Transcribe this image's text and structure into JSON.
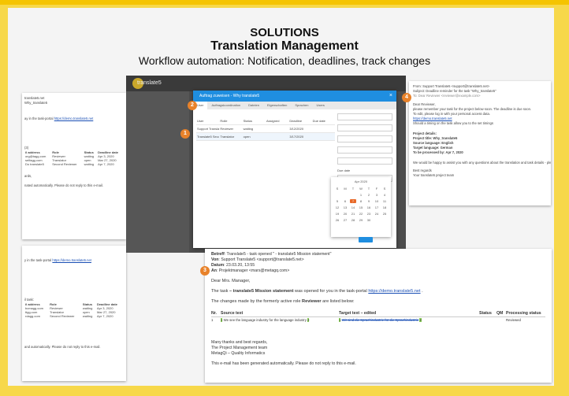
{
  "slide": {
    "title": "SOLUTIONS",
    "subtitle": "Translation Management",
    "tagline": "Workflow automation: Notification, deadlines, track changes"
  },
  "app": {
    "name": "translate5"
  },
  "dialog": {
    "title": "Auftrag zuweisen - Why translate5",
    "tabs": [
      "User",
      "Auftragskoordination",
      "Dateien",
      "Eigenschaften",
      "Sprachen",
      "Users"
    ],
    "columns": [
      "User",
      "Rolle",
      "Status",
      "Assigned",
      "Deadline",
      "Due date"
    ],
    "rows": [
      [
        "Support Translate5 Manager",
        "Reviewer",
        "waiting",
        "",
        "3/12/2020",
        ""
      ],
      [
        "Translate5 Second Reviewer",
        "Translator",
        "open",
        "",
        "3/17/2020",
        ""
      ]
    ],
    "side_label": "Due date",
    "calendar": {
      "header": "Apr 2020",
      "days": [
        "S",
        "M",
        "T",
        "W",
        "T",
        "F",
        "S",
        "",
        "",
        "",
        "1",
        "2",
        "3",
        "4",
        "5",
        "6",
        "7",
        "8",
        "9",
        "10",
        "11",
        "12",
        "13",
        "14",
        "15",
        "16",
        "17",
        "18",
        "19",
        "20",
        "21",
        "22",
        "23",
        "24",
        "25",
        "26",
        "27",
        "28",
        "29",
        "30",
        "",
        ""
      ]
    }
  },
  "email_right": {
    "from": "From: Support Translate5 <support@translate5.net>",
    "subject": "Subject: Deadline reminder for the task \"Why_translate5\"",
    "to": "To: Dear Reviewer <reviewer@example.com>",
    "greeting": "Dear Reviewer,",
    "body1": "please remember your task for the project below soon. The deadline is due soon.",
    "body2": "To edit, please log in with your personal access data.",
    "link": "https://demo.translate5.net",
    "body3": "Should a timing on the task allow you to the set timings",
    "details_title": "Project details:",
    "details": [
      "Project title: Why_translate5",
      "Source language: English",
      "Target language: German",
      "To be processed by: Apr 7, 2020"
    ],
    "closing": "We would be happy to assist you with any questions about the translation and task details - please",
    "regards": "Best regards",
    "sign": "Your translate5 project team"
  },
  "email_left": {
    "line1": "translate5.net",
    "line2": "Why_translate5",
    "portal": "ay in the task-portal",
    "portal_link": "https://demo.translate5.net",
    "users_label": "(3)",
    "table_head": [
      "il address",
      "Role",
      "Status",
      "Deadline date"
    ],
    "table_rows": [
      [
        "org@tagg.com",
        "Reviewer",
        "waiting",
        "Apr 3, 2020"
      ],
      [
        "selfagg.com",
        "Translator",
        "open",
        "Mar 27, 2020"
      ],
      [
        "Do translate5",
        "Second Reviewer",
        "waiting",
        "Apr 7, 2020"
      ]
    ],
    "footer1": "ards,",
    "footer2": "nated automatically. Please do not reply to this e-mail.",
    "portal2": "y in the task-portal",
    "portal2_link": "https://demo.translate5.net",
    "table2_title": "il task:",
    "table2_head": [
      "il address",
      "Role",
      "Status",
      "Deadline date"
    ],
    "table2_rows": [
      [
        "bcmagg.com",
        "Reviewer",
        "waiting",
        "Apr 3, 2020"
      ],
      [
        "ttgg.com",
        "Translator",
        "open",
        "Mar 27, 2020"
      ],
      [
        "rdagg.com",
        "Second Reviewer",
        "waiting",
        "Apr 7, 2020"
      ]
    ],
    "footer3": "and automatically. Please do not reply to this e-mail."
  },
  "email_big": {
    "from_label": "Betreff",
    "from": "Translate5 - task opened \" - translate5 Mission statement\"",
    "von_label": "Von",
    "von": "Support Translate5 <support@translate5.net>",
    "datum_label": "Datum",
    "datum": "23.03.20, 13:55",
    "an_label": "An",
    "an": "Projektmanager <mars@metagq.com>",
    "greeting": "Dear Mrs. Manager,",
    "line1a": "The task",
    "line1b": " – translate5 Mission statement",
    "line1c": " was opened for you in the task-portal ",
    "line1_link": "https://demo.translate5.net",
    "line2a": "The changes made by the formerly active role ",
    "line2b": "Reviewer",
    "line2c": " are listed below:",
    "table_head": [
      "Nr.",
      "Source text",
      "Target text – edited",
      "Status",
      "QM",
      "Processing status"
    ],
    "row_nr": "1",
    "row_source": "We see the language industry for the language industry",
    "row_target": "Wir sind die Sprachindustrie für die Sprachindustrie",
    "row_status": "Reviewed",
    "thanks": "Many thanks and best regards,",
    "team": "The Project Management team",
    "company": "MetagQi – Quality Informatics",
    "footer": "This e-mail has been generated automatically. Please do not reply to this e-mail."
  },
  "badges": [
    "1",
    "2",
    "3",
    "4"
  ]
}
